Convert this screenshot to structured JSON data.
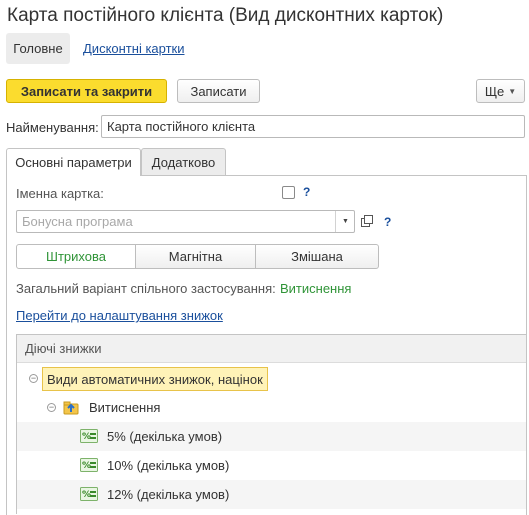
{
  "window": {
    "title": "Карта постійного клієнта (Вид дисконтних карток)"
  },
  "nav": {
    "main": "Головне",
    "link": "Дисконтні картки"
  },
  "toolbar": {
    "save_close": "Записати та закрити",
    "save": "Записати",
    "more": "Ще"
  },
  "form": {
    "name_label": "Найменування:",
    "name_value": "Карта постійного клієнта",
    "tabs": [
      {
        "label": "Основні параметри"
      },
      {
        "label": "Додатково"
      }
    ],
    "named_card_label": "Іменна картка:",
    "help": "?",
    "bonus_placeholder": "Бонусна програма",
    "card_types": [
      "Штрихова",
      "Магнітна",
      "Змішана"
    ],
    "variant_label": "Загальний варіант спільного застосування:",
    "variant_value": "Витиснення",
    "settings_link": "Перейти до налаштування знижок"
  },
  "discounts": {
    "header": "Діючі знижки",
    "root": "Види автоматичних знижок, націнок",
    "group": "Витиснення",
    "items": [
      "5% (декілька умов)",
      "10% (декілька умов)",
      "12% (декілька умов)"
    ]
  },
  "colors": {
    "accent_yellow": "#fbdc2e",
    "link_blue": "#1a4f9c",
    "active_green": "#2f9437"
  }
}
